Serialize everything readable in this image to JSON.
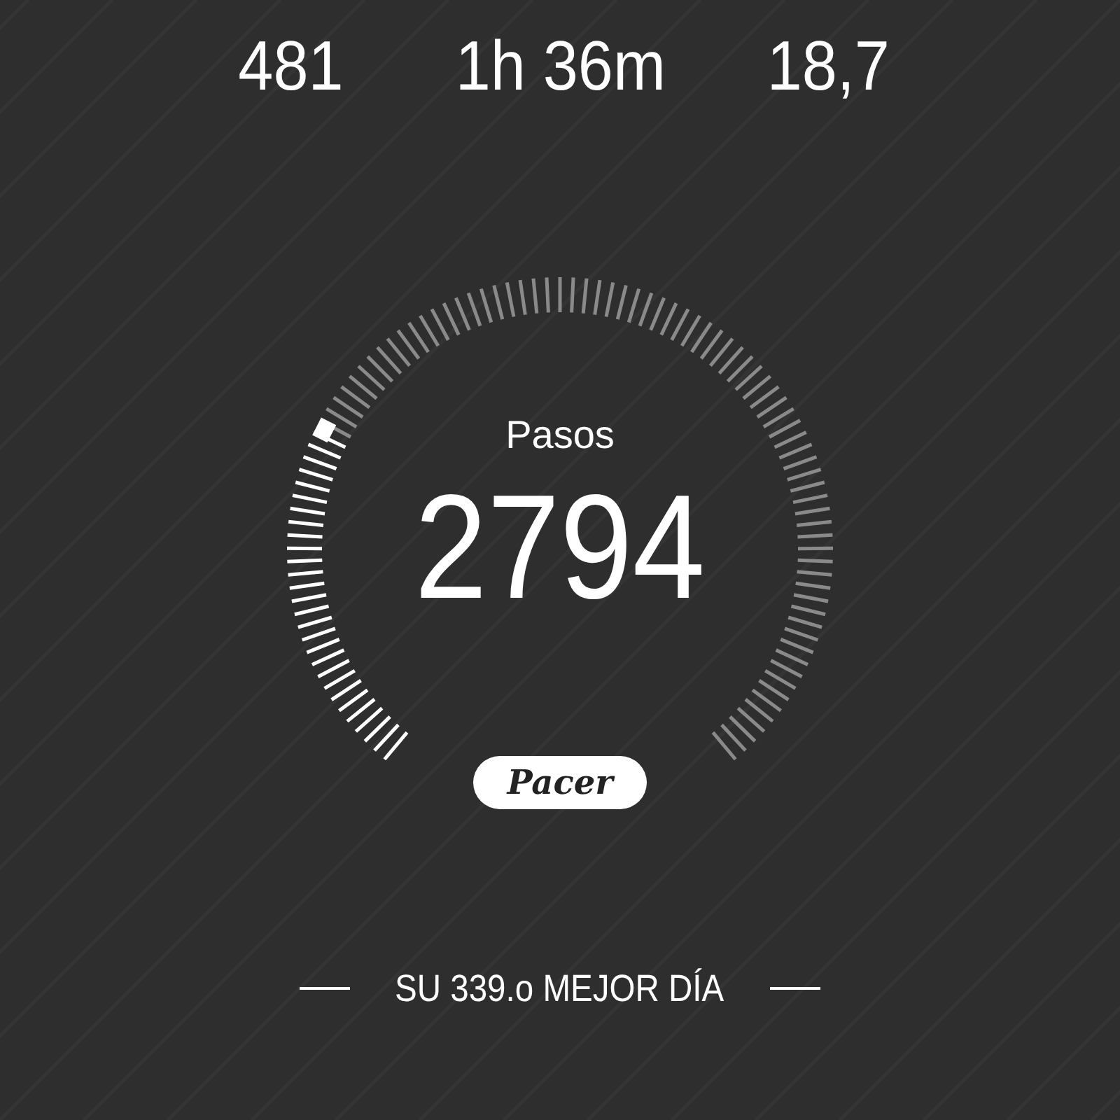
{
  "stats": [
    {
      "value": "481"
    },
    {
      "value": "1h 36m"
    },
    {
      "value": "18,7"
    }
  ],
  "gauge": {
    "label": "Pasos",
    "value": "2794"
  },
  "logo": {
    "text": "Pacer"
  },
  "best_day": {
    "text": "SU 339.o MEJOR DÍA"
  }
}
